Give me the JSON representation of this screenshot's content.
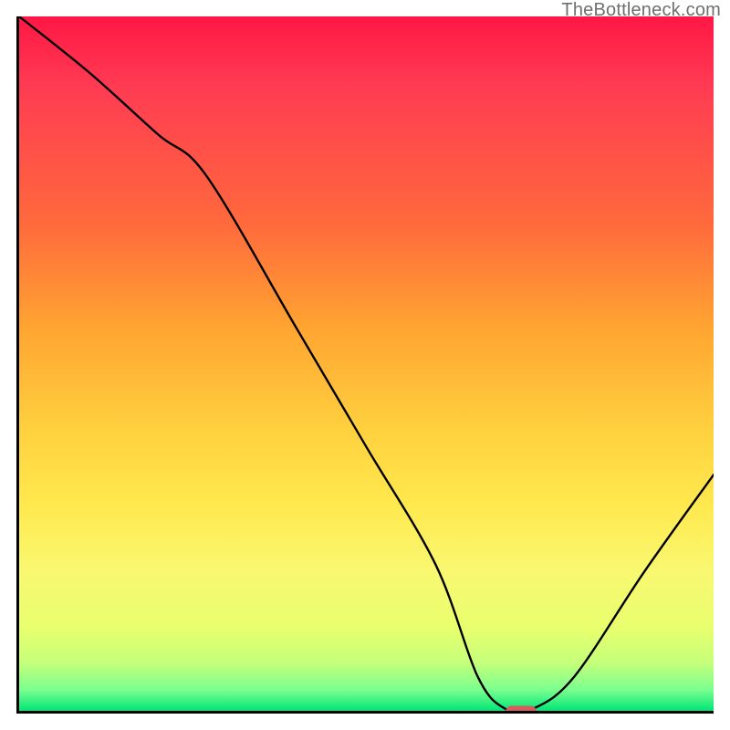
{
  "watermark": "TheBottleneck.com",
  "chart_data": {
    "type": "line",
    "title": "",
    "xlabel": "",
    "ylabel": "",
    "xlim": [
      0,
      100
    ],
    "ylim": [
      0,
      100
    ],
    "x": [
      0,
      10,
      20,
      27,
      40,
      50,
      60,
      66,
      70,
      74,
      80,
      90,
      100
    ],
    "values": [
      100,
      92,
      83,
      77,
      55,
      38,
      21,
      5,
      0.3,
      0.3,
      5,
      20,
      34
    ],
    "marker": {
      "x": 72,
      "y": 0.3
    },
    "gradient_stops": [
      {
        "pos": 0,
        "color": "#ff1744"
      },
      {
        "pos": 30,
        "color": "#ff6a3c"
      },
      {
        "pos": 60,
        "color": "#ffd23f"
      },
      {
        "pos": 80,
        "color": "#f9f871"
      },
      {
        "pos": 97,
        "color": "#7aff8f"
      },
      {
        "pos": 100,
        "color": "#00e676"
      }
    ]
  }
}
